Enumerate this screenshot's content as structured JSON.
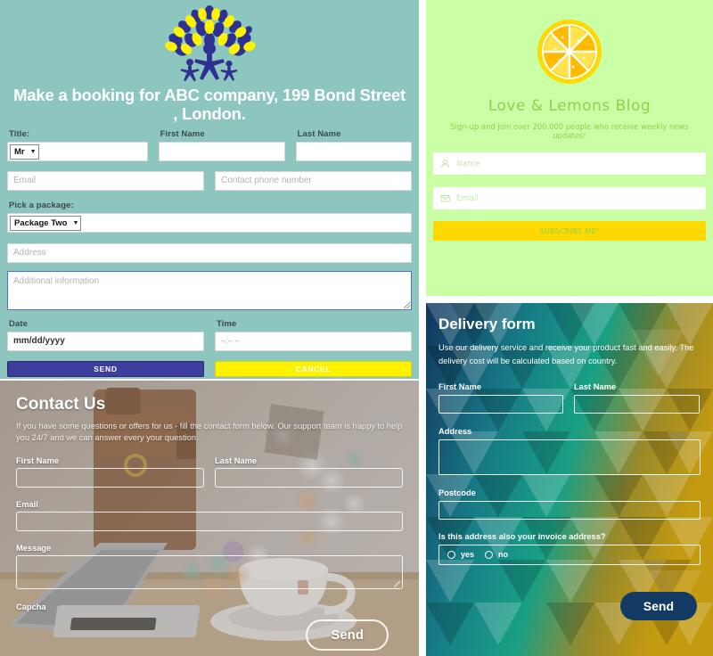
{
  "booking": {
    "logo_icon": "tree-logo",
    "title": "Make a booking for ABC company, 199 Bond Street , London.",
    "title_accent": "#ffffff",
    "background": "#8dc6bf",
    "labels": {
      "title": "Title:",
      "first_name": "First Name",
      "last_name": "Last Name",
      "package": "Pick a package:",
      "date": "Date",
      "time": "Time"
    },
    "title_select_value": "Mr",
    "package_select_value": "Package Two",
    "placeholders": {
      "email": "Email",
      "phone": "Contact phone number",
      "address": "Address",
      "additional": "Additional information"
    },
    "date_value": "mm/dd/yyyy",
    "time_value": "--:-- --",
    "send_label": "SEND",
    "cancel_label": "CANCEL",
    "send_color": "#3f3d9b",
    "cancel_color": "#fff200"
  },
  "contact": {
    "heading": "Contact Us",
    "paragraph": "If you have some questions or offers for us - fill the contact form below. Our support team is happy to help you 24/7 and we can answer every your question.",
    "labels": {
      "first_name": "First Name",
      "last_name": "Last Name",
      "email": "Email",
      "message": "Message",
      "capcha": "Capcha"
    },
    "send_label": "Send"
  },
  "lemon": {
    "logo_icon": "lemon-slice-icon",
    "heading": "Love & Lemons Blog",
    "subtitle": "Sign-up and join over 200.000 people who receive weekly news updates!",
    "name_placeholder": "Name",
    "email_placeholder": "Email",
    "name_icon": "person-icon",
    "email_icon": "envelope-icon",
    "subscribe_label": "SUBSCRIBE ME!",
    "background": "#caffa5",
    "accent": "#8fd14f",
    "button_color": "#ffd900"
  },
  "delivery": {
    "heading": "Delivery form",
    "paragraph": "Use our delivery service and receive your product fast and easily. The delivery cost will be calculated based on country.",
    "labels": {
      "first_name": "First Name",
      "last_name": "Last Name",
      "address": "Address",
      "postcode": "Postcode",
      "invoice_question": "Is this address also your invoice address?"
    },
    "radio_yes": "yes",
    "radio_no": "no",
    "send_label": "Send",
    "send_color": "#123a63"
  }
}
